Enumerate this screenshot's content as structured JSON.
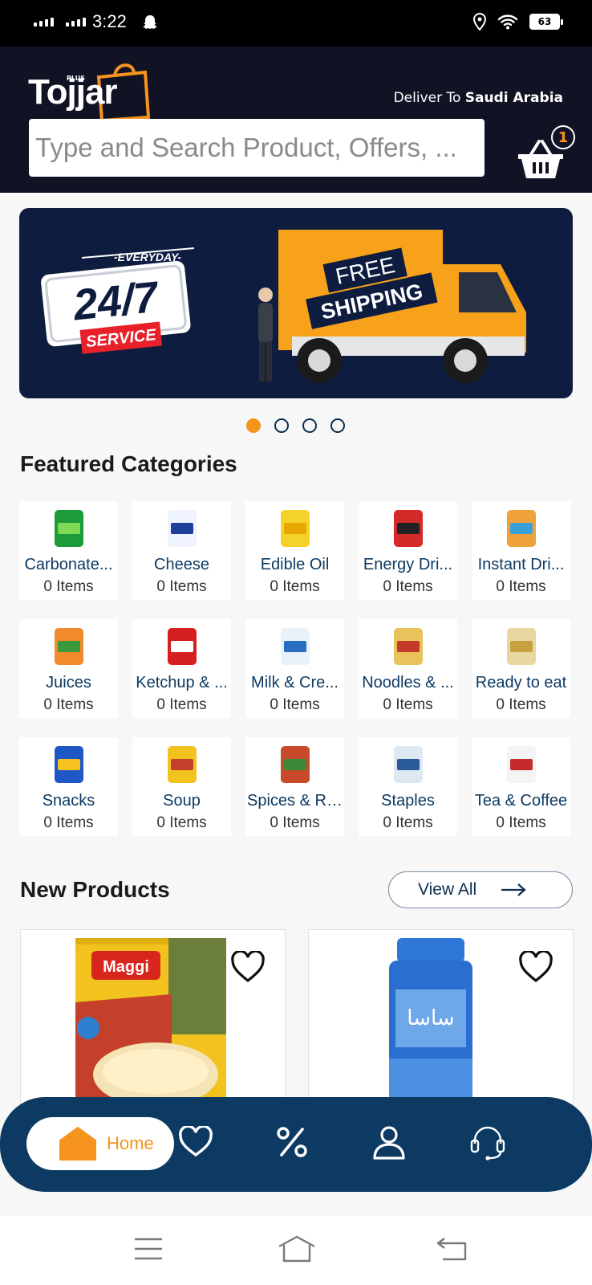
{
  "status_bar": {
    "time": "3:22",
    "battery": "63"
  },
  "header": {
    "logo_text": "Tojjar",
    "logo_plus": "PLUS",
    "deliver_label": "Deliver To",
    "deliver_country": "Saudi Arabia",
    "search_placeholder": "Type and Search Product, Offers, ...",
    "cart_count": "1"
  },
  "banner": {
    "everyday": "-EVERYDAY-",
    "service_hours": "24/7",
    "service": "SERVICE",
    "free": "FREE",
    "shipping": "SHIPPING",
    "slide_count": 4,
    "active_slide": 1
  },
  "featured": {
    "title": "Featured Categories",
    "categories": [
      {
        "name": "Carbonate...",
        "count": "0 Items",
        "icon": "soda-pack-icon"
      },
      {
        "name": "Cheese",
        "count": "0 Items",
        "icon": "cheese-jar-icon"
      },
      {
        "name": "Edible Oil",
        "count": "0 Items",
        "icon": "oil-bottle-icon"
      },
      {
        "name": "Energy Dri...",
        "count": "0 Items",
        "icon": "energy-cans-icon"
      },
      {
        "name": "Instant Dri...",
        "count": "0 Items",
        "icon": "instant-drinks-icon"
      },
      {
        "name": "Juices",
        "count": "0 Items",
        "icon": "juices-icon"
      },
      {
        "name": "Ketchup & ...",
        "count": "0 Items",
        "icon": "ketchup-bottle-icon"
      },
      {
        "name": "Milk & Cre...",
        "count": "0 Items",
        "icon": "milk-cream-icon"
      },
      {
        "name": "Noodles & ...",
        "count": "0 Items",
        "icon": "noodles-pack-icon"
      },
      {
        "name": "Ready to eat",
        "count": "0 Items",
        "icon": "canned-food-icon"
      },
      {
        "name": "Snacks",
        "count": "0 Items",
        "icon": "chips-bag-icon"
      },
      {
        "name": "Soup",
        "count": "0 Items",
        "icon": "soup-pack-icon"
      },
      {
        "name": "Spices & Re...",
        "count": "0 Items",
        "icon": "spices-icon"
      },
      {
        "name": "Staples",
        "count": "0 Items",
        "icon": "staples-bag-icon"
      },
      {
        "name": "Tea & Coffee",
        "count": "0 Items",
        "icon": "tea-box-icon"
      }
    ]
  },
  "new_products": {
    "title": "New Products",
    "view_all": "View All",
    "products": [
      {
        "brand_text": "Maggi",
        "icon": "maggi-soup-pack"
      },
      {
        "brand_text": "ساسا",
        "icon": "sasa-salt-jar"
      }
    ]
  },
  "bottom_nav": {
    "home_label": "Home",
    "items": [
      "home-icon",
      "heart-icon",
      "percent-icon",
      "profile-icon",
      "support-headset-icon"
    ]
  },
  "colors": {
    "accent": "#f7941d",
    "navy": "#0d3a63",
    "header_bg": "#111325"
  }
}
